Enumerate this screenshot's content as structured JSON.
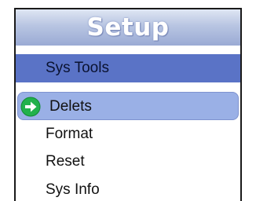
{
  "title": "Setup",
  "section": {
    "label": "Sys Tools"
  },
  "menu": {
    "items": [
      {
        "label": "Delets",
        "selected": true,
        "icon": "green-arrow-icon"
      },
      {
        "label": "Format",
        "selected": false
      },
      {
        "label": "Reset",
        "selected": false
      },
      {
        "label": "Sys Info",
        "selected": false
      }
    ]
  },
  "colors": {
    "title_gradient_top": "#dfe6f3",
    "title_gradient_bottom": "#9aaad4",
    "section_bg": "#5a73c6",
    "selected_bg": "#9ab0e6",
    "arrow_green": "#22b14c"
  }
}
